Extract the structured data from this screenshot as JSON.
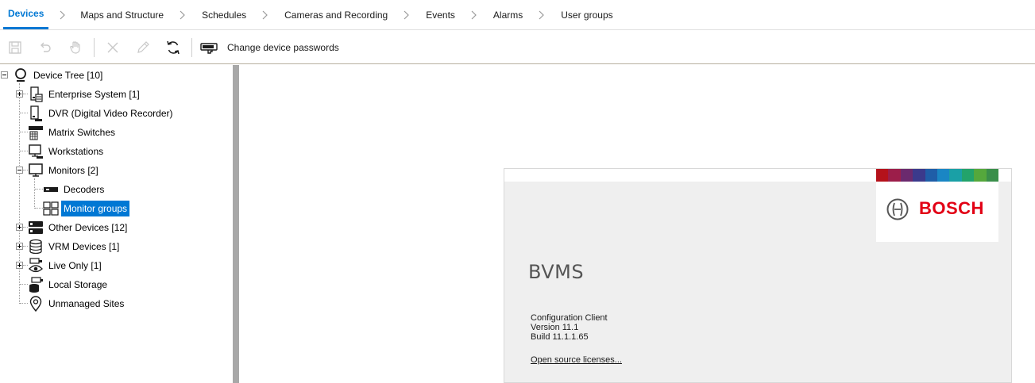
{
  "nav": {
    "tabs": [
      {
        "label": "Devices",
        "active": true
      },
      {
        "label": "Maps and Structure",
        "active": false
      },
      {
        "label": "Schedules",
        "active": false
      },
      {
        "label": "Cameras and Recording",
        "active": false
      },
      {
        "label": "Events",
        "active": false
      },
      {
        "label": "Alarms",
        "active": false
      },
      {
        "label": "User groups",
        "active": false
      }
    ]
  },
  "toolbar": {
    "save_icon": "save-icon",
    "undo_icon": "undo-icon",
    "touch_icon": "hand-icon",
    "delete_icon": "close-icon",
    "edit_icon": "pencil-icon",
    "refresh_icon": "refresh-icon",
    "password_icon": "key-icon",
    "change_passwords_label": "Change device passwords"
  },
  "tree": {
    "root": {
      "label": "Device Tree [10]",
      "icon": "device-tree-icon"
    },
    "items": [
      {
        "label": "Enterprise System [1]",
        "icon": "enterprise-icon"
      },
      {
        "label": "DVR (Digital Video Recorder)",
        "icon": "dvr-icon"
      },
      {
        "label": "Matrix Switches",
        "icon": "matrix-icon"
      },
      {
        "label": "Workstations",
        "icon": "workstation-icon"
      },
      {
        "label": "Monitors [2]",
        "icon": "monitor-icon"
      },
      {
        "label": "Decoders",
        "icon": "decoder-icon"
      },
      {
        "label": "Monitor groups",
        "icon": "monitor-group-icon",
        "selected": true
      },
      {
        "label": "Other Devices [12]",
        "icon": "other-devices-icon"
      },
      {
        "label": "VRM Devices [1]",
        "icon": "database-icon"
      },
      {
        "label": "Live Only [1]",
        "icon": "eye-icon"
      },
      {
        "label": "Local Storage",
        "icon": "local-storage-icon"
      },
      {
        "label": "Unmanaged Sites",
        "icon": "location-pin-icon"
      }
    ]
  },
  "splash": {
    "brand": "BOSCH",
    "product": "BVMS",
    "app_name": "Configuration Client",
    "version": "Version 11.1",
    "build": "Build 11.1.1.65",
    "license_link": "Open source licenses...",
    "brand_color": "#e20015"
  },
  "colors": {
    "accent": "#0078d4",
    "splitter": "#a8a8a8"
  }
}
